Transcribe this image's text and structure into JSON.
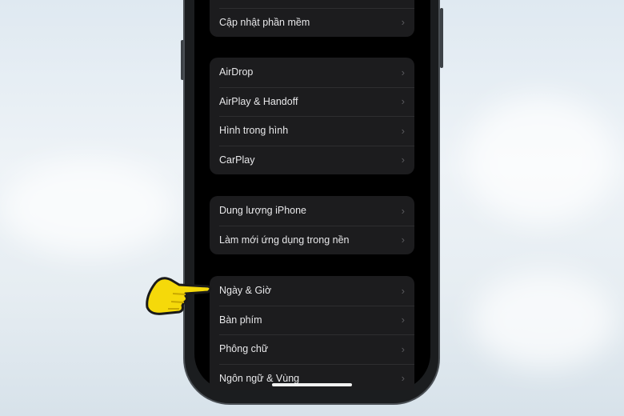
{
  "settings": {
    "group1": [
      {
        "label": "Cập nhật phần mềm"
      }
    ],
    "group2": [
      {
        "label": "AirDrop"
      },
      {
        "label": "AirPlay & Handoff"
      },
      {
        "label": "Hình trong hình"
      },
      {
        "label": "CarPlay"
      }
    ],
    "group3": [
      {
        "label": "Dung lượng iPhone"
      },
      {
        "label": "Làm mới ứng dụng trong nền"
      }
    ],
    "group4": [
      {
        "label": "Ngày & Giờ"
      },
      {
        "label": "Bàn phím"
      },
      {
        "label": "Phông chữ"
      },
      {
        "label": "Ngôn ngữ & Vùng"
      }
    ]
  },
  "chevron": "›",
  "pointer_icon": "pointing-hand-icon",
  "colors": {
    "pointer": "#f5d90a",
    "row_bg": "#1c1c1e",
    "screen_bg": "#000000"
  }
}
